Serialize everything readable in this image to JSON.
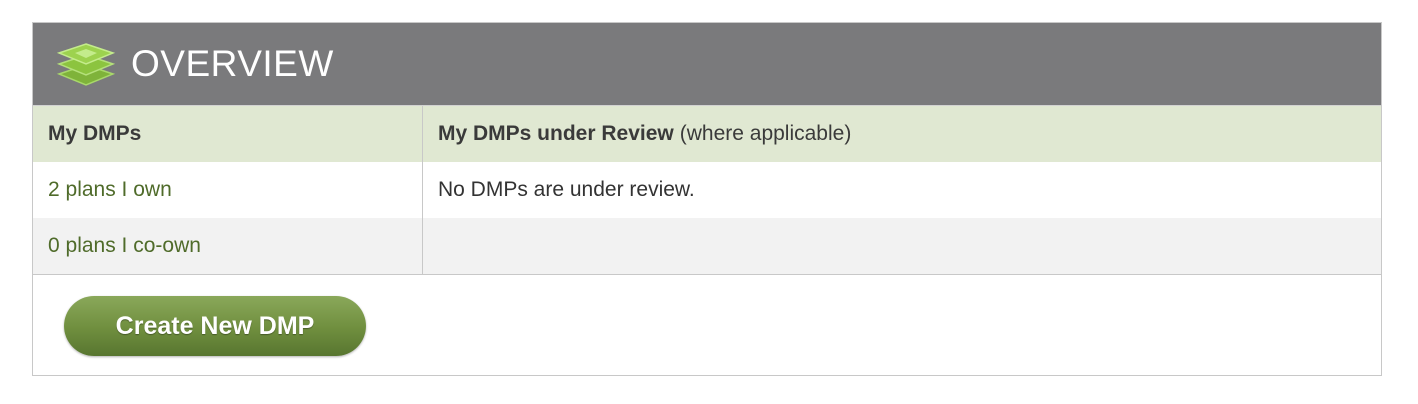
{
  "overview": {
    "title": "OVERVIEW",
    "icon": "layers-icon",
    "accent_color": "#8cc43f"
  },
  "table": {
    "headers": {
      "left": "My DMPs",
      "right": "My DMPs under Review",
      "right_note": "(where applicable)"
    },
    "rows": [
      {
        "left": "2 plans I own",
        "right": "No DMPs are under review."
      },
      {
        "left": "0 plans I co-own",
        "right": ""
      }
    ]
  },
  "actions": {
    "create_label": "Create New DMP"
  }
}
